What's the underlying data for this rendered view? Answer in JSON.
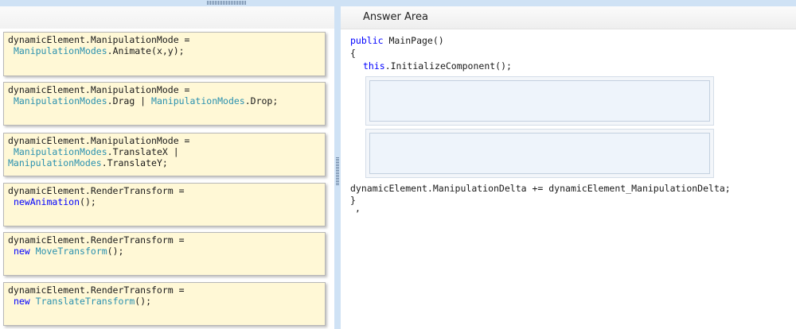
{
  "answer_area": {
    "title": "Answer Area"
  },
  "cards": [
    {
      "line1": "dynamicElement.ManipulationMode =",
      "line2_type": "ManipulationModes",
      "line2_rest": ".Animate(x,y);"
    },
    {
      "line1": "dynamicElement.ManipulationMode =",
      "line2_type1": "ManipulationModes",
      "line2_mid": ".Drag | ",
      "line2_type2": "ManipulationModes",
      "line2_rest": ".Drop;"
    },
    {
      "line1": "dynamicElement.ManipulationMode =",
      "line2_type": "ManipulationModes",
      "line2_rest": ".TranslateX |",
      "line3_type": "ManipulationModes",
      "line3_rest": ".TranslateY;"
    },
    {
      "line1": "dynamicElement.RenderTransform =",
      "line2_kw": "newAnimation",
      "line2_rest": "();"
    },
    {
      "line1": "dynamicElement.RenderTransform =",
      "line2_kw": "new",
      "line2_type": "MoveTransform",
      "line2_rest": "();"
    },
    {
      "line1": "dynamicElement.RenderTransform =",
      "line2_kw": "new",
      "line2_type": "TranslateTransform",
      "line2_rest": "();"
    }
  ],
  "code": {
    "line1_kw": "public",
    "line1_rest": " MainPage()",
    "open_brace": "{",
    "line3_kw": "this",
    "line3_rest": ".InitializeComponent();",
    "delta_line": "dynamicElement.ManipulationDelta += dynamicElement_ManipulationDelta;",
    "close_brace": "}",
    "trailing": ","
  },
  "colors": {
    "keyword": "#0000ff",
    "type": "#2b91af",
    "card_bg": "#fff8d6",
    "splitter": "#cfe2f5"
  }
}
